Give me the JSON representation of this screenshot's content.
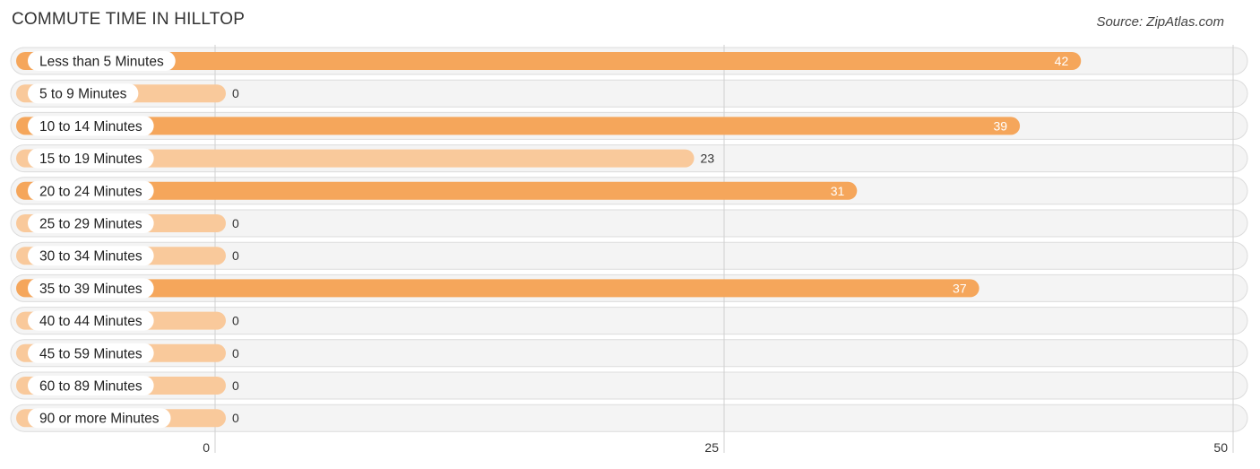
{
  "header": {
    "title": "COMMUTE TIME IN HILLTOP",
    "source": "Source: ZipAtlas.com"
  },
  "colors": {
    "bar_strong": "#f5a65b",
    "bar_light": "#f9c99b",
    "row_bg": "#f4f4f4"
  },
  "chart_data": {
    "type": "bar",
    "orientation": "horizontal",
    "title": "COMMUTE TIME IN HILLTOP",
    "xlabel": "",
    "ylabel": "",
    "xlim": [
      0,
      50
    ],
    "xticks": [
      0,
      25,
      50
    ],
    "xtick_labels": [
      "0",
      "25",
      "50"
    ],
    "grid": true,
    "categories": [
      "Less than 5 Minutes",
      "5 to 9 Minutes",
      "10 to 14 Minutes",
      "15 to 19 Minutes",
      "20 to 24 Minutes",
      "25 to 29 Minutes",
      "30 to 34 Minutes",
      "35 to 39 Minutes",
      "40 to 44 Minutes",
      "45 to 59 Minutes",
      "60 to 89 Minutes",
      "90 or more Minutes"
    ],
    "values": [
      42,
      0,
      39,
      23,
      31,
      0,
      0,
      37,
      0,
      0,
      0,
      0
    ],
    "value_labels": [
      "42",
      "0",
      "39",
      "23",
      "31",
      "0",
      "0",
      "37",
      "0",
      "0",
      "0",
      "0"
    ]
  }
}
